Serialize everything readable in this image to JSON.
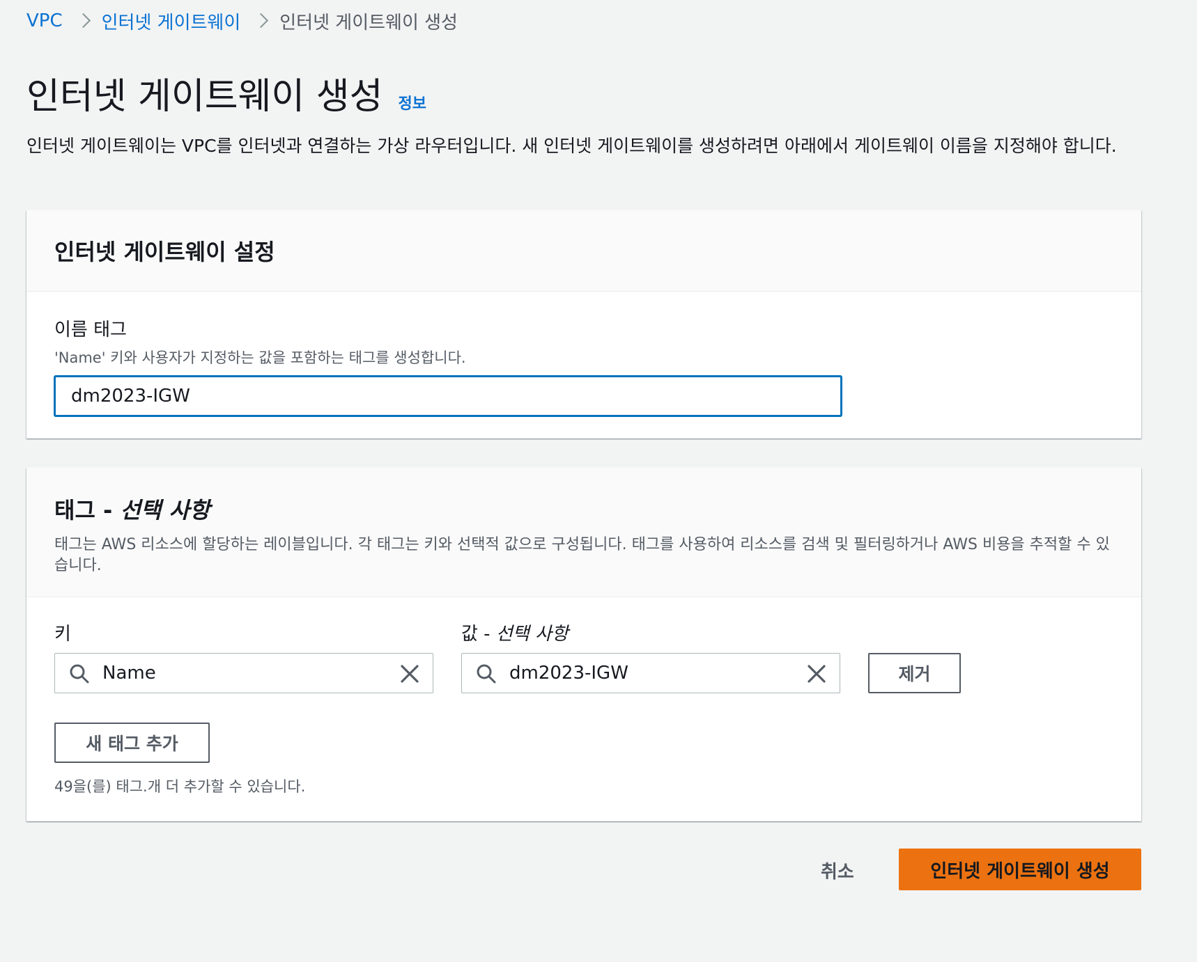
{
  "breadcrumb": {
    "items": [
      {
        "label": "VPC"
      },
      {
        "label": "인터넷 게이트웨이"
      },
      {
        "label": "인터넷 게이트웨이 생성"
      }
    ]
  },
  "header": {
    "title": "인터넷 게이트웨이 생성",
    "info_link": "정보",
    "description": "인터넷 게이트웨이는 VPC를 인터넷과 연결하는 가상 라우터입니다. 새 인터넷 게이트웨이를 생성하려면 아래에서 게이트웨이 이름을 지정해야 합니다."
  },
  "settings_panel": {
    "title": "인터넷 게이트웨이 설정",
    "name_tag": {
      "label": "이름 태그",
      "description": "'Name' 키와 사용자가 지정하는 값을 포함하는 태그를 생성합니다.",
      "value": "dm2023-IGW"
    }
  },
  "tags_panel": {
    "title_main": "태그 - ",
    "title_optional": "선택 사항",
    "description": "태그는 AWS 리소스에 할당하는 레이블입니다. 각 태그는 키와 선택적 값으로 구성됩니다. 태그를 사용하여 리소스를 검색 및 필터링하거나 AWS 비용을 추적할 수 있습니다.",
    "key_label": "키",
    "value_label_main": "값 - ",
    "value_label_optional": "선택 사항",
    "tags": [
      {
        "key": "Name",
        "value": "dm2023-IGW",
        "remove_label": "제거"
      }
    ],
    "add_tag_label": "새 태그 추가",
    "remaining_hint": "49을(를) 태그.개 더 추가할 수 있습니다."
  },
  "footer": {
    "cancel_label": "취소",
    "submit_label": "인터넷 게이트웨이 생성"
  },
  "colors": {
    "link": "#0972d3",
    "primary_button": "#ec7211",
    "focus_border": "#0073bb",
    "page_background": "#f2f3f3"
  }
}
